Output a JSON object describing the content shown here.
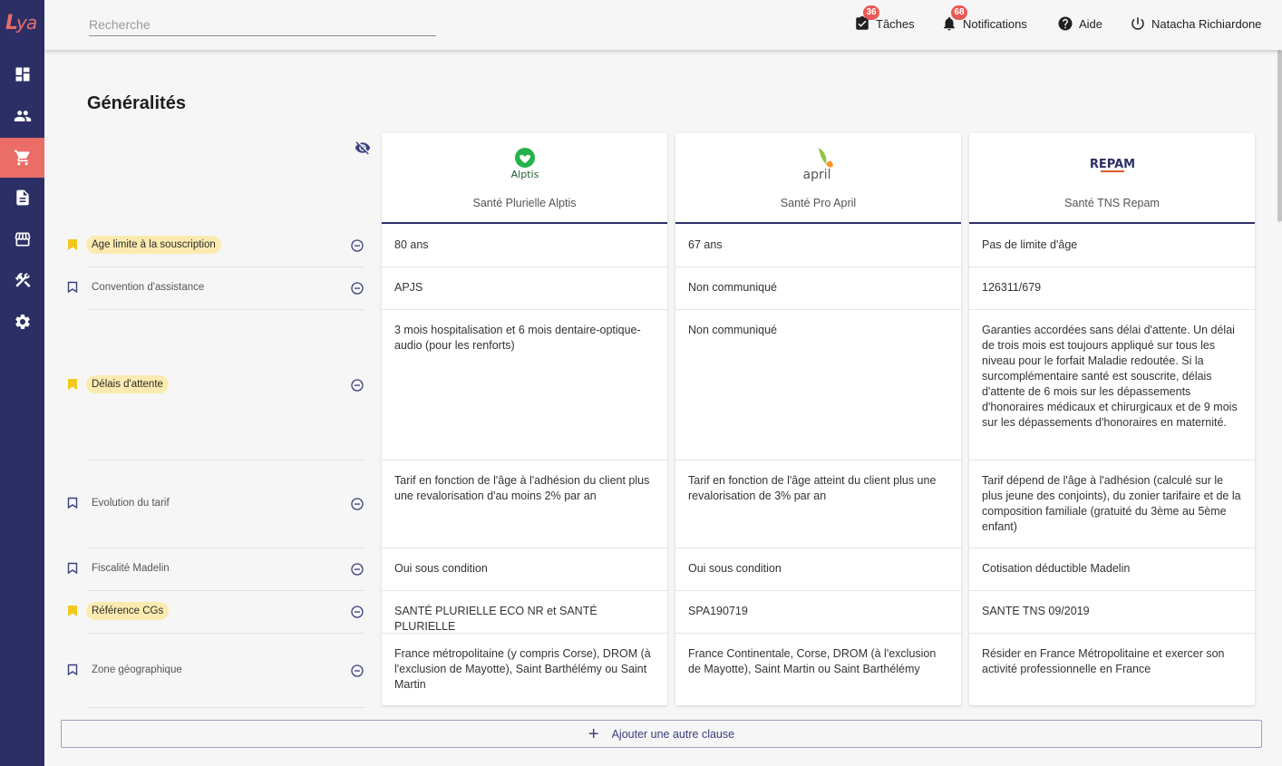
{
  "search": {
    "placeholder": "Recherche"
  },
  "topbar": {
    "tasks": {
      "label": "Tâches",
      "count": "36"
    },
    "notifications": {
      "label": "Notifications",
      "count": "68"
    },
    "help": {
      "label": "Aide"
    },
    "user": {
      "label": "Natacha Richiardone"
    }
  },
  "sidebar": {
    "logo": "Lya",
    "items": [
      {
        "icon": "dashboard-icon"
      },
      {
        "icon": "users-icon"
      },
      {
        "icon": "cart-icon",
        "active": true
      },
      {
        "icon": "document-icon"
      },
      {
        "icon": "store-icon"
      },
      {
        "icon": "tools-icon"
      },
      {
        "icon": "settings-icon"
      }
    ]
  },
  "section": {
    "title": "Généralités"
  },
  "products": [
    {
      "brand": "Alptis",
      "name": "Santé Plurielle Alptis"
    },
    {
      "brand": "april",
      "name": "Santé Pro April"
    },
    {
      "brand": "REPAM",
      "name": "Santé TNS Repam"
    }
  ],
  "rows": [
    {
      "label": "Age limite à la souscription",
      "highlighted": true,
      "values": [
        "80 ans",
        "67 ans",
        "Pas de limite d'âge"
      ]
    },
    {
      "label": "Convention d'assistance",
      "highlighted": false,
      "values": [
        "APJS",
        "Non communiqué",
        "126311/679"
      ]
    },
    {
      "label": "Délais d'attente",
      "highlighted": true,
      "values": [
        "3 mois hospitalisation et 6 mois dentaire-optique-audio (pour les renforts)",
        "Non communiqué",
        "Garanties accordées sans délai d'attente. Un délai de trois mois est toujours appliqué sur tous les niveau pour le forfait Maladie redoutée. Si la surcomplémentaire santé est souscrite, délais d'attente de 6 mois sur les dépassements d'honoraires médicaux et chirurgicaux et de 9 mois sur les dépassements d'honoraires en maternité."
      ]
    },
    {
      "label": "Evolution du tarif",
      "highlighted": false,
      "values": [
        "Tarif en fonction de l'âge à l'adhésion du client plus une revalorisation d'au moins 2% par an",
        "Tarif en fonction de l'âge atteint du client plus une revalorisation de 3% par an",
        "Tarif dépend de l'âge à l'adhésion (calculé sur le plus jeune des conjoints), du zonier tarifaire et de la composition familiale (gratuité du 3ème au 5ème enfant)"
      ]
    },
    {
      "label": "Fiscalité Madelin",
      "highlighted": false,
      "values": [
        "Oui sous condition",
        "Oui sous condition",
        "Cotisation déductible Madelin"
      ]
    },
    {
      "label": "Référence CGs",
      "highlighted": true,
      "values": [
        "SANTÉ PLURIELLE ECO NR et SANTÉ PLURIELLE",
        "SPA190719",
        "SANTE TNS 09/2019"
      ]
    },
    {
      "label": "Zone géographique",
      "highlighted": false,
      "values": [
        "France métropolitaine (y compris Corse), DROM (à l'exclusion de Mayotte), Saint Barthélémy ou Saint Martin",
        "France Continentale, Corse, DROM (à l'exclusion de Mayotte), Saint Martin ou Saint Barthélémy",
        "Résider en France Métropolitaine et exercer son activité professionnelle en France"
      ]
    }
  ],
  "add_clause": {
    "label": "Ajouter une autre clause"
  },
  "colors": {
    "sidebar": "#2c2f66",
    "active": "#ea6d67",
    "highlight": "#fcebb0",
    "accent": "#2c2f66",
    "badge": "#e95a55"
  }
}
